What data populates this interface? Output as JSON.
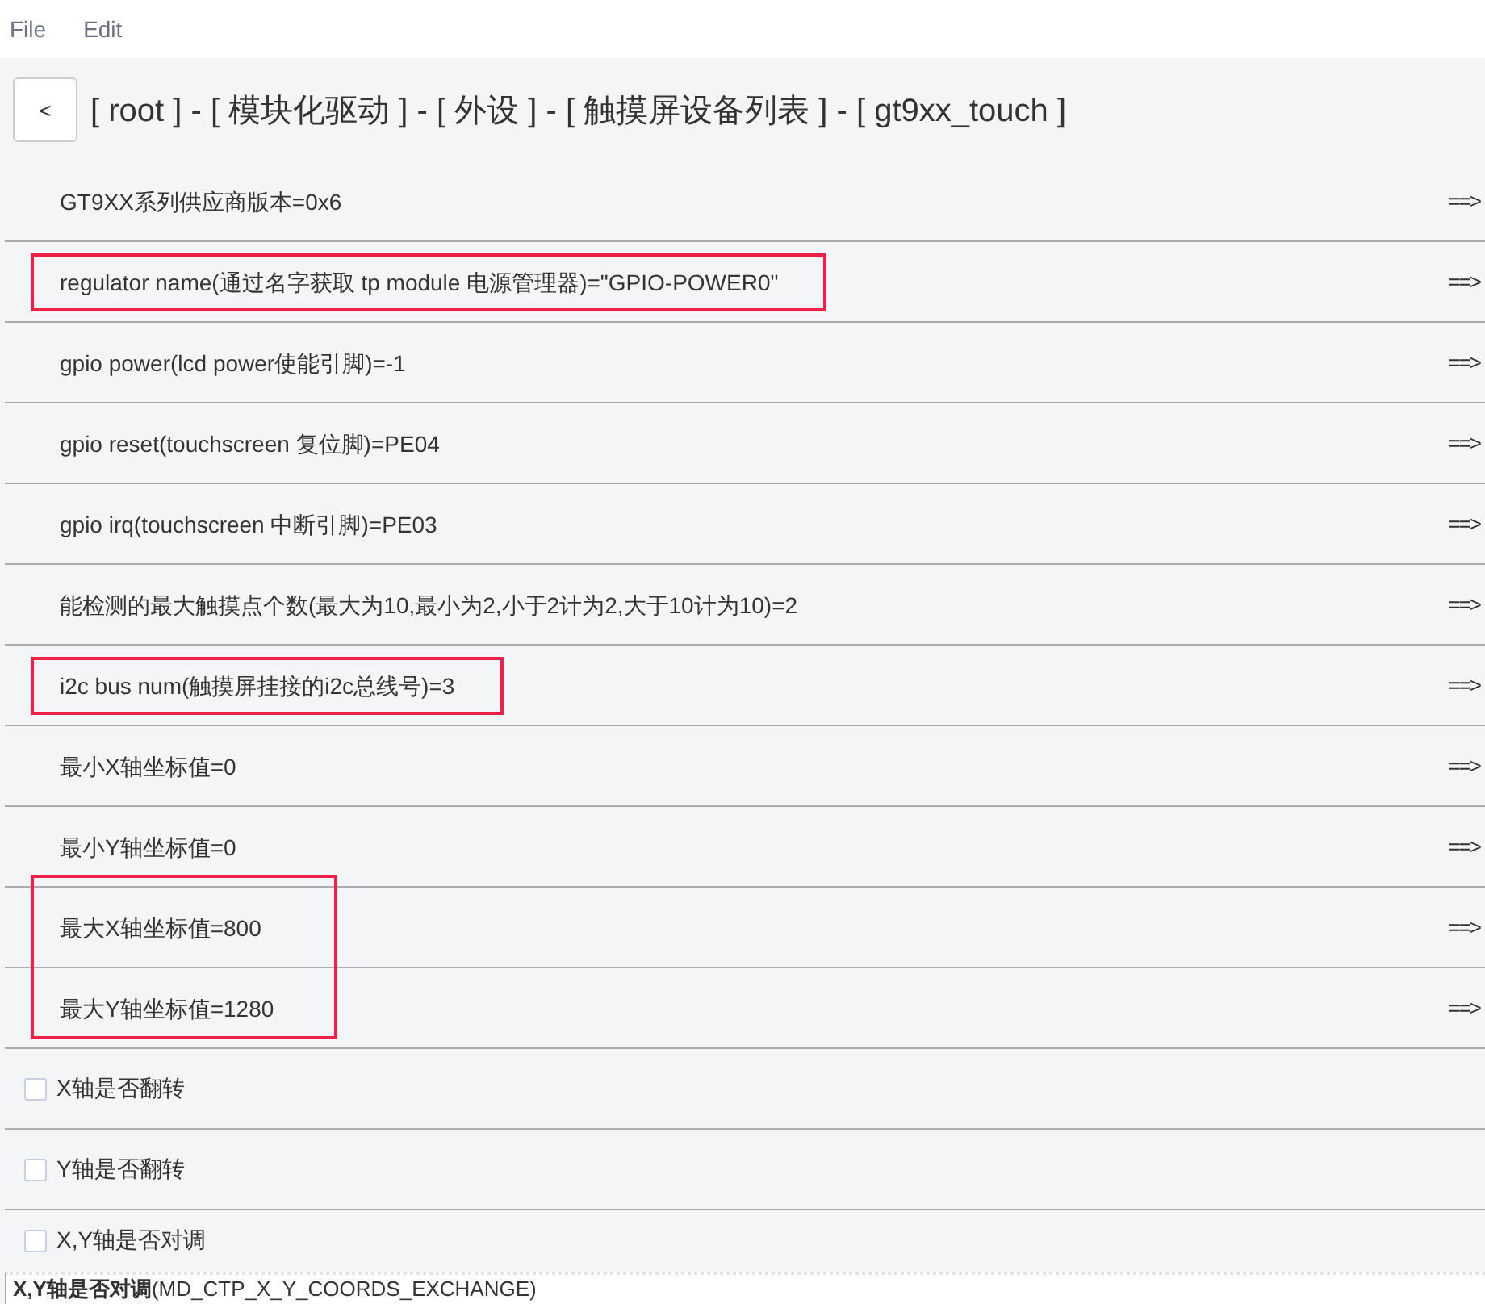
{
  "menu": [
    "File",
    "Edit"
  ],
  "back_button": "<",
  "breadcrumb": "[ root ] - [ 模块化驱动 ] - [ 外设 ] - [ 触摸屏设备列表 ] - [ gt9xx_touch ]",
  "rows": [
    {
      "kind": "value",
      "text": "GT9XX系列供应商版本=0x6",
      "arrow": "==>",
      "highlighted": false
    },
    {
      "kind": "value",
      "text": "regulator name(通过名字获取 tp module 电源管理器)=\"GPIO-POWER0\"",
      "arrow": "==>",
      "highlighted": true
    },
    {
      "kind": "value",
      "text": "gpio power(lcd power使能引脚)=-1",
      "arrow": "==>",
      "highlighted": false
    },
    {
      "kind": "value",
      "text": "gpio reset(touchscreen 复位脚)=PE04",
      "arrow": "==>",
      "highlighted": false
    },
    {
      "kind": "value",
      "text": "gpio irq(touchscreen 中断引脚)=PE03",
      "arrow": "==>",
      "highlighted": false
    },
    {
      "kind": "value",
      "text": "能检测的最大触摸点个数(最大为10,最小为2,小于2计为2,大于10计为10)=2",
      "arrow": "==>",
      "highlighted": false
    },
    {
      "kind": "value",
      "text": "i2c bus num(触摸屏挂接的i2c总线号)=3",
      "arrow": "==>",
      "highlighted": true
    },
    {
      "kind": "value",
      "text": "最小X轴坐标值=0",
      "arrow": "==>",
      "highlighted": false
    },
    {
      "kind": "value",
      "text": "最小Y轴坐标值=0",
      "arrow": "==>",
      "highlighted": false
    },
    {
      "kind": "value",
      "text": "最大X轴坐标值=800",
      "arrow": "==>",
      "highlighted": true
    },
    {
      "kind": "value",
      "text": "最大Y轴坐标值=1280",
      "arrow": "==>",
      "highlighted": true
    },
    {
      "kind": "checkbox",
      "text": "X轴是否翻转",
      "checked": false
    },
    {
      "kind": "checkbox",
      "text": "Y轴是否翻转",
      "checked": false
    },
    {
      "kind": "checkbox",
      "text": "X,Y轴是否对调",
      "checked": false
    }
  ],
  "help_text": "**X,Y轴是否对调**(MD_CTP_X_Y_COORDS_EXCHANGE)"
}
